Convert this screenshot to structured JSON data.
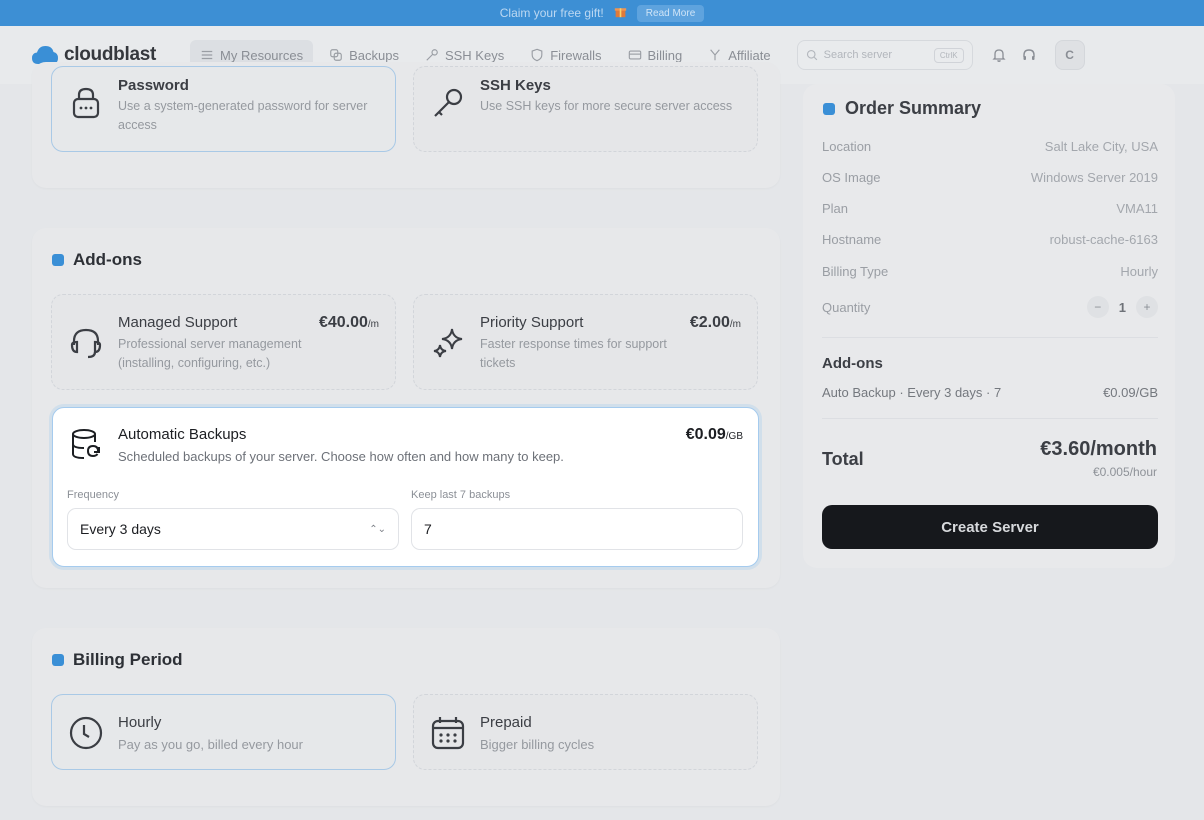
{
  "promo": {
    "text": "Claim your free gift!",
    "gift_icon": "gift-icon",
    "read_more": "Read More"
  },
  "brand": {
    "name": "cloudblast",
    "color": "#3a8fd6"
  },
  "nav": {
    "items": [
      {
        "label": "My Resources",
        "icon": "list-icon",
        "active": true
      },
      {
        "label": "Backups",
        "icon": "backup-icon"
      },
      {
        "label": "SSH Keys",
        "icon": "key-icon"
      },
      {
        "label": "Firewalls",
        "icon": "shield-icon"
      },
      {
        "label": "Billing",
        "icon": "card-icon"
      },
      {
        "label": "Affiliate",
        "icon": "fork-icon"
      }
    ],
    "search_placeholder": "Search server",
    "search_shortcut": "CtrlK",
    "avatar_letter": "C"
  },
  "auth": {
    "password": {
      "title": "Password",
      "desc": "Use a system-generated password for server access"
    },
    "ssh": {
      "title": "SSH Keys",
      "desc": "Use SSH keys for more secure server access"
    }
  },
  "addons": {
    "title": "Add-ons",
    "managed": {
      "title": "Managed Support",
      "price": "€40.00",
      "unit": "/m",
      "desc_line1": "Professional server management",
      "desc_line2": "(installing, configuring, etc.)"
    },
    "priority": {
      "title": "Priority Support",
      "price": "€2.00",
      "unit": "/m",
      "desc_line1": "Faster response times for support",
      "desc_line2": "tickets"
    },
    "backups": {
      "title": "Automatic Backups",
      "price": "€0.09",
      "unit": "/GB",
      "desc": "Scheduled backups of your server. Choose how often and how many to keep.",
      "frequency_label": "Frequency",
      "frequency_value": "Every 3 days",
      "keep_label": "Keep last 7 backups",
      "keep_value": "7"
    }
  },
  "billing_period": {
    "title": "Billing Period",
    "hourly": {
      "title": "Hourly",
      "desc": "Pay as you go, billed every hour"
    },
    "prepaid": {
      "title": "Prepaid",
      "desc": "Bigger billing cycles"
    }
  },
  "summary": {
    "title": "Order Summary",
    "rows": [
      {
        "label": "Location",
        "value": "Salt Lake City, USA"
      },
      {
        "label": "OS Image",
        "value": "Windows Server 2019"
      },
      {
        "label": "Plan",
        "value": "VMA11"
      },
      {
        "label": "Hostname",
        "value": "robust-cache-6163"
      },
      {
        "label": "Billing Type",
        "value": "Hourly"
      }
    ],
    "quantity_label": "Quantity",
    "quantity_value": "1",
    "addons_title": "Add-ons",
    "addon_line": "Auto Backup · Every 3 days · 7",
    "addon_price": "€0.09/GB",
    "total_label": "Total",
    "total_value": "€3.60/month",
    "total_hourly": "€0.005/hour",
    "create_button": "Create Server"
  }
}
